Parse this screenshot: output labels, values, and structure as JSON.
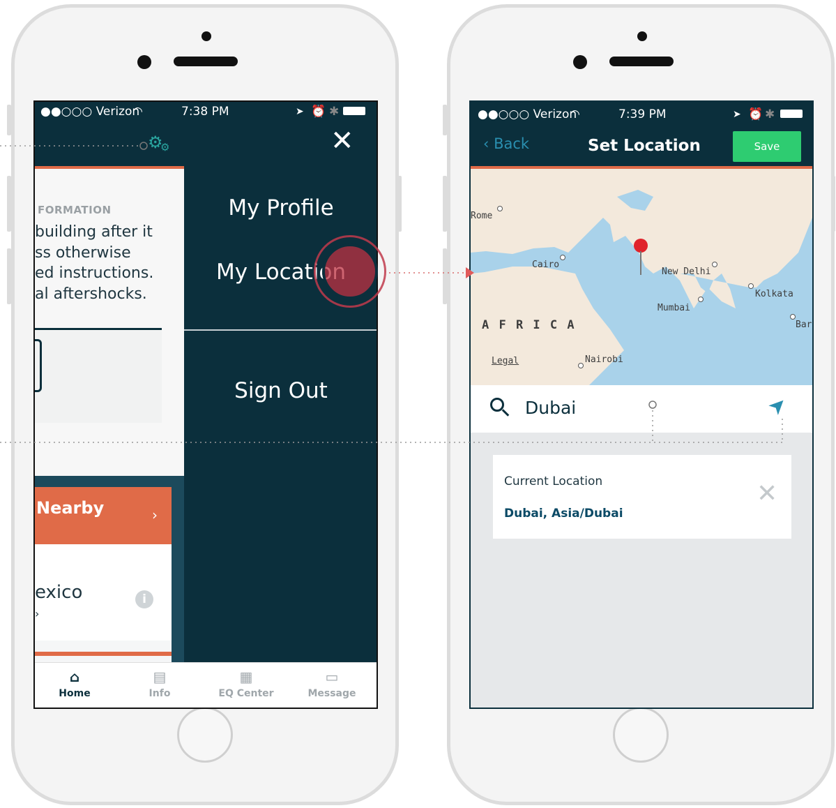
{
  "left_screen": {
    "status": {
      "carrier": "●●○○○ Verizon",
      "time": "7:38 PM"
    },
    "underlying": {
      "section_title": "FORMATION",
      "body_lines": [
        "building after it",
        "ss otherwise",
        "ed instructions.",
        "al aftershocks."
      ],
      "nearby_label": "Nearby",
      "list_text": "exico"
    },
    "menu": {
      "my_profile": "My Profile",
      "my_location": "My Location",
      "sign_out": "Sign Out"
    },
    "tabs": [
      {
        "label": "Home",
        "icon": "home-icon"
      },
      {
        "label": "Info",
        "icon": "info-icon"
      },
      {
        "label": "EQ Center",
        "icon": "building-icon"
      },
      {
        "label": "Message",
        "icon": "message-icon"
      }
    ]
  },
  "right_screen": {
    "status": {
      "carrier": "●●○○○ Verizon",
      "time": "7:39 PM"
    },
    "nav": {
      "back": "Back",
      "title": "Set Location",
      "save": "Save"
    },
    "map_labels": {
      "rome": "Rome",
      "cairo": "Cairo",
      "new_delhi": "New Delhi",
      "kolkata": "Kolkata",
      "mumbai": "Mumbai",
      "africa": "A F R I C A",
      "bar": "Bar",
      "legal": "Legal",
      "nairobi": "Nairobi"
    },
    "search": {
      "value": "Dubai"
    },
    "current_location": {
      "label": "Current Location",
      "value": "Dubai, Asia/Dubai"
    }
  },
  "colors": {
    "navy": "#0b2f3c",
    "orange": "#e06b48",
    "green": "#2ecc71",
    "teal": "#2a8fb0",
    "highlight": "#c0394b"
  }
}
